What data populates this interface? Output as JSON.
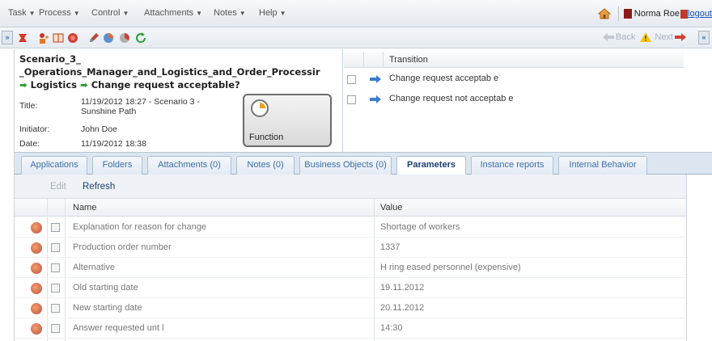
{
  "menu": {
    "items": [
      "Task",
      "Process",
      "Control",
      "Attachments",
      "Notes",
      "Help"
    ],
    "user_name": "Norma Roe",
    "logout_label": "logout"
  },
  "toolbar": {
    "collapse_left": "»",
    "collapse_right": "«",
    "back_label": "Back",
    "next_label": "Next",
    "icons": [
      "process-icon",
      "organization-icon",
      "book-icon",
      "record-icon",
      "edit-icon",
      "chart-icon",
      "history-icon",
      "refresh-icon"
    ]
  },
  "scenario": {
    "title_line1": "Scenario_3_",
    "title_line2": "_Operations_Manager_and_Logistics_and_Order_Processir",
    "title_line3_part1": "Logistics",
    "title_line3_part2": "Change request acceptable?",
    "title_label": "Title:",
    "title_value": "11/19/2012 18:27 - Scenario 3 - Sunshine Path",
    "initiator_label": "Initiator:",
    "initiator_value": "John Doe",
    "date_label": "Date:",
    "date_value": "11/19/2012 18:38",
    "function_label": "Function"
  },
  "transition": {
    "header": "Transition",
    "rows": [
      "Change request acceptab e",
      "Change request not acceptab e"
    ]
  },
  "tabs": [
    "Applications",
    "Folders",
    "Attachments (0)",
    "Notes (0)",
    "Business Objects (0)",
    "Parameters",
    "Instance reports",
    "Internal Behavior"
  ],
  "active_tab": "Parameters",
  "grid_toolbar": {
    "edit_label": "Edit",
    "refresh_label": "Refresh"
  },
  "parameters": {
    "columns": [
      "Name",
      "Value"
    ],
    "rows": [
      {
        "name": "Explanation for reason for change",
        "value": "Shortage of workers"
      },
      {
        "name": "Production order number",
        "value": "1337"
      },
      {
        "name": "Alternative",
        "value": "H ring eased personnel (expensive)"
      },
      {
        "name": "Old starting date",
        "value": "19.11.2012"
      },
      {
        "name": "New starting date",
        "value": "20.11.2012"
      },
      {
        "name": "Answer requested unt l",
        "value": "14:30"
      }
    ]
  },
  "colors": {
    "accent": "#3d6ea6",
    "arrow_green": "#2ea02e"
  }
}
